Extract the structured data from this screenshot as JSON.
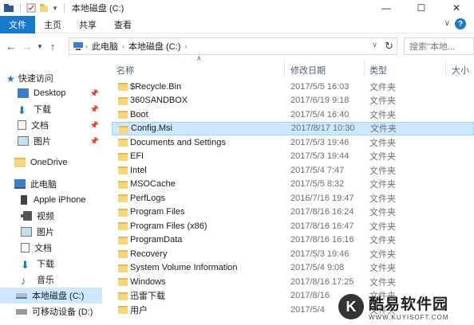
{
  "titlebar": {
    "title": "本地磁盘 (C:)",
    "minimize": "—",
    "maximize": "☐",
    "close": "✕"
  },
  "ribbon": {
    "tabs": [
      "文件",
      "主页",
      "共享",
      "查看"
    ],
    "help": "?",
    "expand": "∨"
  },
  "addressbar": {
    "crumbs": [
      "此电脑",
      "本地磁盘 (C:)"
    ],
    "search_placeholder": "搜索\"本地..."
  },
  "navpane": {
    "items": [
      {
        "label": "快速访问",
        "icon": "star-icon",
        "pinned": false
      },
      {
        "label": "Desktop",
        "icon": "desktop-folder-icon",
        "pinned": true
      },
      {
        "label": "下载",
        "icon": "download-icon",
        "pinned": true
      },
      {
        "label": "文档",
        "icon": "document-icon",
        "pinned": true
      },
      {
        "label": "图片",
        "icon": "picture-icon",
        "pinned": true
      },
      {
        "label": "OneDrive",
        "icon": "folder-icon",
        "pinned": false
      },
      {
        "label": "此电脑",
        "icon": "computer-icon",
        "pinned": false
      },
      {
        "label": "Apple iPhone",
        "icon": "phone-icon",
        "pinned": false
      },
      {
        "label": "视频",
        "icon": "video-icon",
        "pinned": false
      },
      {
        "label": "图片",
        "icon": "picture-icon",
        "pinned": false
      },
      {
        "label": "文档",
        "icon": "document-icon",
        "pinned": false
      },
      {
        "label": "下载",
        "icon": "download-icon",
        "pinned": false
      },
      {
        "label": "音乐",
        "icon": "music-icon",
        "pinned": false
      },
      {
        "label": "本地磁盘 (C:)",
        "icon": "drive-icon",
        "pinned": false
      },
      {
        "label": "可移动设备 (D:)",
        "icon": "removable-drive-icon",
        "pinned": false
      }
    ]
  },
  "columns": {
    "name": "名称",
    "date": "修改日期",
    "type": "类型",
    "size": "大小"
  },
  "files": [
    {
      "name": "$Recycle.Bin",
      "date": "2017/5/5 16:03",
      "type": "文件夹"
    },
    {
      "name": "360SANDBOX",
      "date": "2017/6/19 9:18",
      "type": "文件夹"
    },
    {
      "name": "Boot",
      "date": "2017/5/4 16:40",
      "type": "文件夹"
    },
    {
      "name": "Config.Msi",
      "date": "2017/8/17 10:30",
      "type": "文件夹"
    },
    {
      "name": "Documents and Settings",
      "date": "2017/5/3 19:46",
      "type": "文件夹"
    },
    {
      "name": "EFI",
      "date": "2017/5/3 19:44",
      "type": "文件夹"
    },
    {
      "name": "Intel",
      "date": "2017/5/4 7:47",
      "type": "文件夹"
    },
    {
      "name": "MSOCache",
      "date": "2017/5/5 8:32",
      "type": "文件夹"
    },
    {
      "name": "PerfLogs",
      "date": "2016/7/16 19:47",
      "type": "文件夹"
    },
    {
      "name": "Program Files",
      "date": "2017/8/16 16:24",
      "type": "文件夹"
    },
    {
      "name": "Program Files (x86)",
      "date": "2017/8/16 16:47",
      "type": "文件夹"
    },
    {
      "name": "ProgramData",
      "date": "2017/8/16 16:16",
      "type": "文件夹"
    },
    {
      "name": "Recovery",
      "date": "2017/5/3 19:46",
      "type": "文件夹"
    },
    {
      "name": "System Volume Information",
      "date": "2017/5/4 9:08",
      "type": "文件夹"
    },
    {
      "name": "Windows",
      "date": "2017/8/16 17:25",
      "type": "文件夹"
    },
    {
      "name": "迅雷下载",
      "date": "2017/8/16",
      "type": "文件夹"
    },
    {
      "name": "用户",
      "date": "2017/5/4",
      "type": "文件夹"
    }
  ],
  "selected_file": "Config.Msi",
  "watermark": {
    "logo": "K",
    "text": "酷易软件园",
    "sub": "WWW.KUYISOFT.COM"
  },
  "colors": {
    "accent": "#1979ca",
    "selection": "#cce8ff",
    "folder": "#f6d67a"
  }
}
